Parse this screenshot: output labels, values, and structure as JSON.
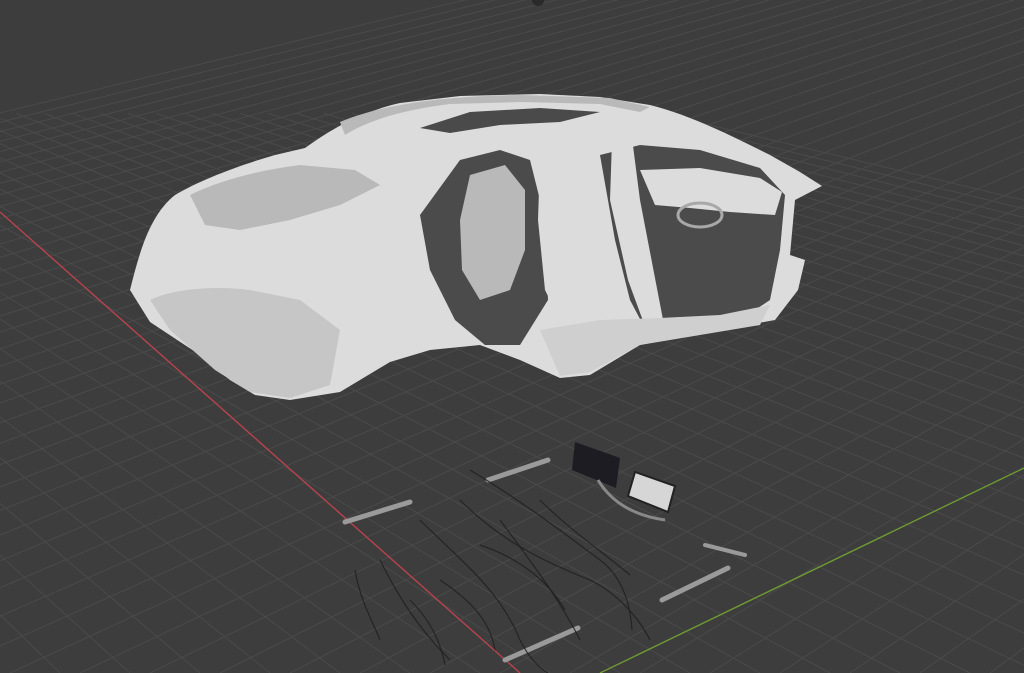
{
  "viewport": {
    "background_color": "#3d3d3d",
    "grid_line_color": "#4a4a4a",
    "x_axis_color": "#b8434d",
    "y_axis_color": "#6e9a33",
    "model_color": "#dcdcdc",
    "model_shadow_color": "#b9b9b9",
    "parts_color": "#9a9a9a",
    "cable_color": "#202020",
    "screen_color": "#1c1c22"
  },
  "objects": [
    {
      "name": "car-interior-shell",
      "label": ""
    },
    {
      "name": "infotainment-display",
      "label": ""
    },
    {
      "name": "loose-cable-harness",
      "label": ""
    },
    {
      "name": "interior-trim-strips",
      "label": ""
    }
  ]
}
